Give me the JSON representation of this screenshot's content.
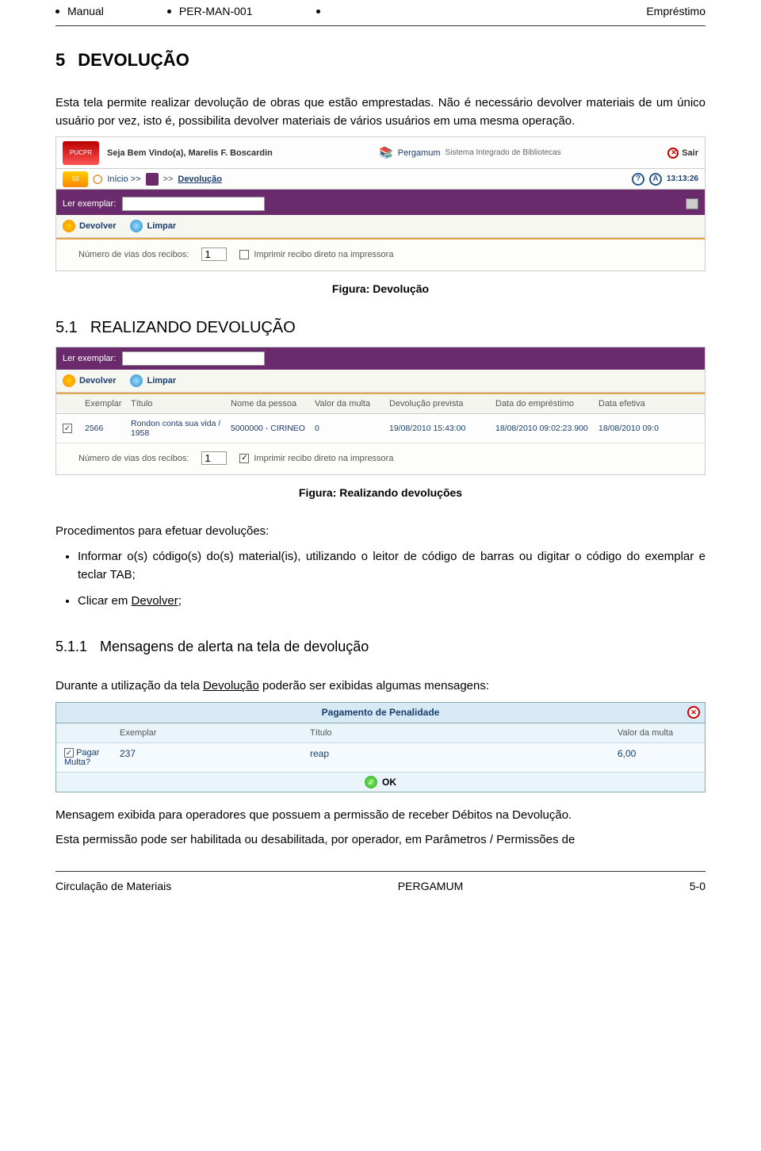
{
  "header": {
    "left": "Manual",
    "center": "PER-MAN-001",
    "right": "Empréstimo"
  },
  "sec5": {
    "num": "5",
    "title": "DEVOLUÇÃO"
  },
  "intro": "Esta tela permite realizar devolução de obras que estão emprestadas. Não é necessário devolver materiais de um único usuário por vez, isto é, possibilita devolver materiais de vários usuários em uma mesma operação.",
  "fig1": {
    "welcome": "Seja Bem Vindo(a), Marelis F. Boscardin",
    "system": "Sistema Integrado de Bibliotecas",
    "pergamum": "Pergamum",
    "sair": "Sair",
    "inicio": "Início >>",
    "dev": "Devolução",
    "time": "13:13:26",
    "ler": "Ler exemplar:",
    "devolver": "Devolver",
    "limpar": "Limpar",
    "vias_label": "Número de vias dos recibos:",
    "vias_value": "1",
    "imprimir": "Imprimir recibo direto na impressora",
    "caption": "Figura: Devolução"
  },
  "sec51": {
    "num": "5.1",
    "title": "REALIZANDO DEVOLUÇÃO"
  },
  "fig2": {
    "ler": "Ler exemplar:",
    "devolver": "Devolver",
    "limpar": "Limpar",
    "headers": {
      "ex": "Exemplar",
      "tit": "Título",
      "nome": "Nome da pessoa",
      "val": "Valor da multa",
      "prev": "Devolução prevista",
      "emp": "Data do empréstimo",
      "efe": "Data efetiva"
    },
    "row": {
      "ex": "2566",
      "tit": "Rondon conta sua vida / 1958",
      "nome": "5000000 - CIRINEO",
      "val": "0",
      "prev": "19/08/2010 15:43:00",
      "emp": "18/08/2010 09:02:23.900",
      "efe": "18/08/2010 09:0"
    },
    "vias_label": "Número de vias dos recibos:",
    "vias_value": "1",
    "imprimir": "Imprimir recibo direto na impressora",
    "caption": "Figura: Realizando devoluções"
  },
  "proc": {
    "lead": "Procedimentos para efetuar devoluções:",
    "item1": "Informar o(s) código(s) do(s) material(is), utilizando o leitor de código de barras ou digitar o código do exemplar e teclar TAB;",
    "item2_pre": "Clicar em ",
    "item2_link": "Devolver",
    "item2_suf": ";"
  },
  "sec511": {
    "num": "5.1.1",
    "title": "Mensagens de alerta na tela de devolução"
  },
  "msg_intro_pre": "Durante a utilização da tela ",
  "msg_intro_u": "Devolução",
  "msg_intro_suf": " poderão ser exibidas algumas mensagens:",
  "modal": {
    "title": "Pagamento de Penalidade",
    "h_ex": "Exemplar",
    "h_tit": "Título",
    "h_val": "Valor da multa",
    "pagar": "Pagar Multa?",
    "ex": "237",
    "tit": "reap",
    "val": "6,00",
    "ok": "OK"
  },
  "after_modal1": "Mensagem exibida para operadores que possuem a permissão de receber Débitos na Devolução.",
  "after_modal2": "Esta permissão pode ser habilitada ou desabilitada, por operador, em Parâmetros / Permissões de",
  "footer": {
    "left": "Circulação de Materiais",
    "center": "PERGAMUM",
    "right": "5-0"
  }
}
